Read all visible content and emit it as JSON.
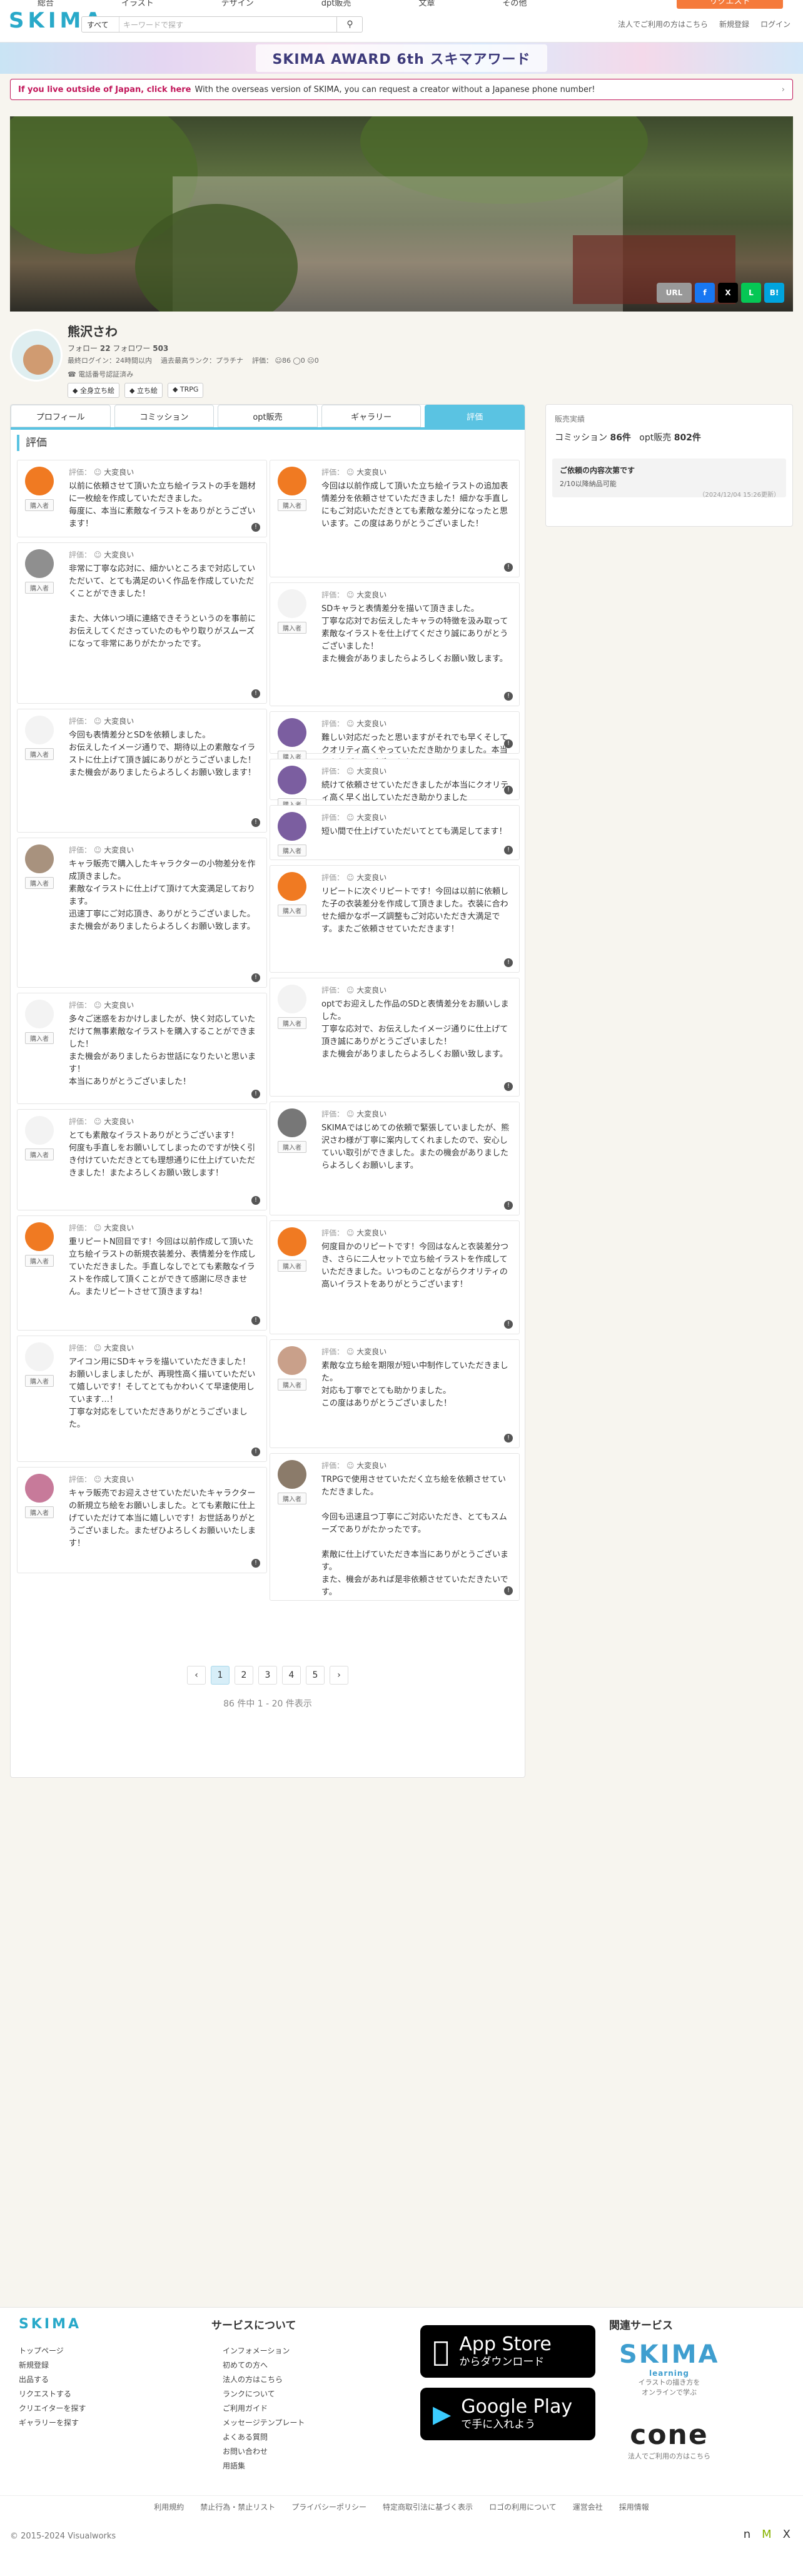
{
  "header": {
    "top_nav": [
      "総合",
      "イラスト",
      "デザイン",
      "dpt販売",
      "文章",
      "その他"
    ],
    "orange_button": "リクエスト",
    "logo": "SKIMA",
    "search_select": "すべて",
    "search_placeholder": "キーワードで探す",
    "overseas_link": "法人でご利用の方はこちら",
    "register": "新規登録",
    "login": "ログイン"
  },
  "banner": {
    "text": "SKIMA AWARD 6th スキマアワード"
  },
  "notice": {
    "strong": "If you live outside of Japan, click here",
    "text": "With the overseas version of SKIMA, you can request a creator without a Japanese phone number!"
  },
  "share": {
    "url_label": "URL",
    "fb": "f",
    "x": "X",
    "line": "L",
    "hatena": "B!"
  },
  "profile": {
    "name": "熊沢さわ",
    "follow_label": "フォロー",
    "follow_count": "22",
    "follower_label": "フォロワー",
    "follower_count": "503",
    "login_info": "最終ログイン：24時間以内",
    "rank": "過去最高ランク：プラチナ",
    "rating_label": "評価：",
    "rating_good": "86",
    "rating_mid": "0",
    "rating_bad": "0",
    "verified": "電話番号認証済み",
    "tags": [
      "全身立ち絵",
      "立ち絵",
      "TRPG"
    ]
  },
  "tabs": [
    "プロフィール",
    "コミッション",
    "opt販売",
    "ギャラリー",
    "評価"
  ],
  "section_title": "評価",
  "buyer_label": "購入者",
  "rating_prefix": "評価：",
  "rating_word": "大変良い",
  "left_reviews": [
    {
      "text": "以前に依頼させて頂いた立ち絵イラストの手を題材に一枚絵を作成していただきました。\n毎度に、本当に素敵なイラストをありがとうございます！"
    },
    {
      "text": "非常に丁寧な応対に、細かいところまで対応していただいて、とても満足のいく作品を作成していただくことができました！\n\nまた、大体いつ頃に連絡できそうというのを事前にお伝えしてくださっていたのもやり取りがスムーズになって非常にありがたかったです。"
    },
    {
      "text": "今回も表情差分とSDを依頼しました。\nお伝えしたイメージ通りで、期待以上の素敵なイラストに仕上げて頂き誠にありがとうございました！\nまた機会がありましたらよろしくお願い致します！"
    },
    {
      "text": "キャラ販売で購入したキャラクターの小物差分を作成頂きました。\n素敵なイラストに仕上げて頂けて大変満足しております。\n迅速丁寧にご対応頂き、ありがとうございました。\nまた機会がありましたらよろしくお願い致します。"
    },
    {
      "text": "多々ご迷惑をおかけしましたが、快く対応していただけて無事素敵なイラストを購入することができました！\nまた機会がありましたらお世話になりたいと思います！\n本当にありがとうございました！"
    },
    {
      "text": "とても素敵なイラストありがとうございます！\n何度も手直しをお願いしてしまったのですが快く引き付けていただきとても理想通りに仕上げていただきました！またよろしくお願い致します！"
    },
    {
      "text": "重リピートN回目です！今回は以前作成して頂いた立ち絵イラストの新規衣装差分、表情差分を作成していただきました。手直しなしでとても素敵なイラストを作成して頂くことができて感謝に尽きません。またリピートさせて頂きますね！"
    },
    {
      "text": "アイコン用にSDキャラを描いていただきました！\nお願いしましましたが、再現性高く描いていただいて嬉しいです！そしてとてもかわいくて早速使用しています…！\n丁寧な対応をしていただきありがとうございました。"
    },
    {
      "text": "キャラ販売でお迎えさせていただいたキャラクターの新規立ち絵をお願いしました。とても素敵に仕上げていただけて本当に嬉しいです！お世話ありがとうございました。またぜひよろしくお願いいたします！"
    }
  ],
  "right_reviews": [
    {
      "text": "今回は以前作成して頂いた立ち絵イラストの追加表情差分を依頼させていただきました！細かな手直しにもご対応いただきとても素敵な差分になったと思います。この度はありがとうございました！"
    },
    {
      "text": "SDキャラと表情差分を描いて頂きました。\n丁寧な応対でお伝えしたキャラの特徴を汲み取って素敵なイラストを仕上げてくださり誠にありがとうございました！\nまた機会がありましたらよろしくお願い致します。"
    },
    {
      "text": "難しい対応だったと思いますがそれでも早くそしてクオリティ高くやっていただき助かりました。本当にありがとうございます"
    },
    {
      "text": "続けて依頼させていただきましたが本当にクオリティ高く早く出していただき助かりました"
    },
    {
      "text": "短い間で仕上げていただいてとても満足してます！"
    },
    {
      "text": "リピートに次ぐリピートです！今回は以前に依頼した子の衣装差分を作成して頂きました。衣装に合わせた細かなポーズ調整もご対応いただき大満足です。またご依頼させていただきます！"
    },
    {
      "text": "optでお迎えした作品のSDと表情差分をお願いしました。\n丁寧な応対で、お伝えしたイメージ通りに仕上げて頂き誠にありがとうございました！\nまた機会がありましたらよろしくお願い致します。"
    },
    {
      "text": "SKIMAではじめての依頼で緊張していましたが、熊沢さわ様が丁寧に案内してくれましたので、安心していい取引ができました。またの機会がありましたらよろしくお願いします。"
    },
    {
      "text": "何度目かのリピートです！今回はなんと衣装差分つき、さらに二人セットで立ち絵イラストを作成していただきました。いつものことながらクオリティの高いイラストをありがとうございます！"
    },
    {
      "text": "素敵な立ち絵を期限が短い中制作していただきました。\n対応も丁寧でとても助かりました。\nこの度はありがとうございました！"
    },
    {
      "text": "TRPGで使用させていただく立ち絵を依頼させていただきました。\n\n今回も迅速且つ丁寧にご対応いただき、とてもスムーズでありがたかったです。\n\n素敵に仕上げていただき本当にありがとうございます。\nまた、機会があれば是非依頼させていただきたいです。"
    }
  ],
  "pager": {
    "prev": "‹",
    "pages": [
      "1",
      "2",
      "3",
      "4",
      "5"
    ],
    "next": "›",
    "note": "86 件中 1 - 20 件表示"
  },
  "sidebar": {
    "heading": "販売実績",
    "commission_label": "コミッション",
    "commission_count": "86件",
    "opt_label": "opt販売",
    "opt_count": "802件",
    "box_title": "ご依頼の内容次第です",
    "box_sub": "2/10以降納品可能",
    "box_date": "（2024/12/04 15:26更新）"
  },
  "footer": {
    "logo": "SKIMA",
    "links_left": [
      "トップページ",
      "新規登録",
      "出品する",
      "リクエストする",
      "クリエイターを探す",
      "ギャラリーを探す"
    ],
    "about_heading": "サービスについて",
    "links_about": [
      "インフォメーション",
      "初めての方へ",
      "法人の方はこちら",
      "ランクについて",
      "ご利用ガイド",
      "メッセージテンプレート",
      "よくある質問",
      "お問い合わせ",
      "用語集"
    ],
    "app_store_small": "",
    "app_store_big": "App Store",
    "app_store_sub": "からダウンロード",
    "google_big": "Google Play",
    "google_sub": "で手に入れよう",
    "related_heading": "関連サービス",
    "skima_learning": "SKIMA",
    "skima_learning_sub": "learning",
    "skima_learning_desc": "イラストの描き方を\nオンラインで学ぶ",
    "cone": "cone",
    "cone_desc": "法人でご利用の方はこちら",
    "bottom_links": [
      "利用規約",
      "禁止行為・禁止リスト",
      "プライバシーポリシー",
      "特定商取引法に基づく表示",
      "ロゴの利用について",
      "運営会社",
      "採用情報"
    ],
    "copyright": "© 2015-2024 Visualworks",
    "social": [
      "n",
      "M",
      "X"
    ]
  }
}
